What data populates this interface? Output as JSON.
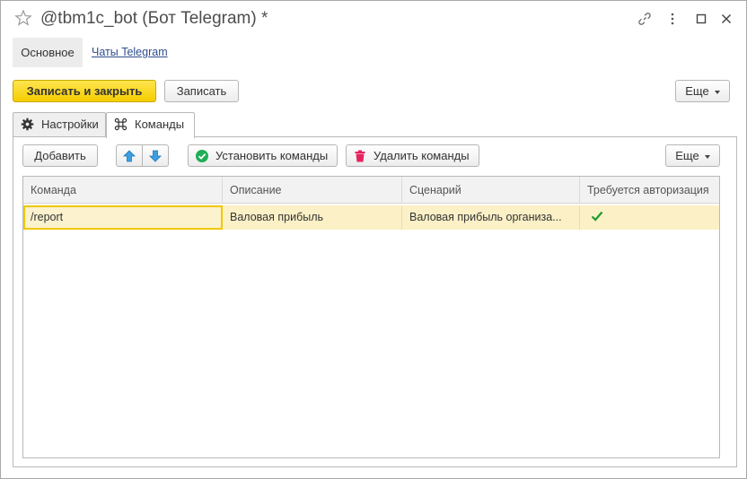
{
  "window": {
    "title": "@tbm1c_bot (Бот Telegram) *",
    "icons": [
      "star-icon",
      "link-icon",
      "more-vertical-icon",
      "maximize-icon",
      "close-icon"
    ]
  },
  "nav": {
    "main": "Основное",
    "telegram_chats": "Чаты Telegram"
  },
  "toolbar": {
    "save_close": "Записать и закрыть",
    "save": "Записать",
    "more": "Еще"
  },
  "tabs": [
    {
      "label": "Настройки",
      "icon": "gear-icon",
      "active": false
    },
    {
      "label": "Команды",
      "icon": "command-icon",
      "active": true
    }
  ],
  "commands_toolbar": {
    "add": "Добавить",
    "move_up_icon": "arrow-up-icon",
    "move_down_icon": "arrow-down-icon",
    "set_commands": "Установить команды",
    "delete_commands": "Удалить команды",
    "more": "Еще"
  },
  "table": {
    "columns": [
      "Команда",
      "Описание",
      "Сценарий",
      "Требуется авторизация"
    ],
    "rows": [
      {
        "command": "/report",
        "description": "Валовая прибыль",
        "scenario": "Валовая прибыль организа...",
        "auth_required": true
      }
    ]
  },
  "colors": {
    "primary_button": "#f5cd00",
    "selected_row": "#fbf0c6",
    "link": "#2f4d8f",
    "check": "#1a9a2e"
  }
}
